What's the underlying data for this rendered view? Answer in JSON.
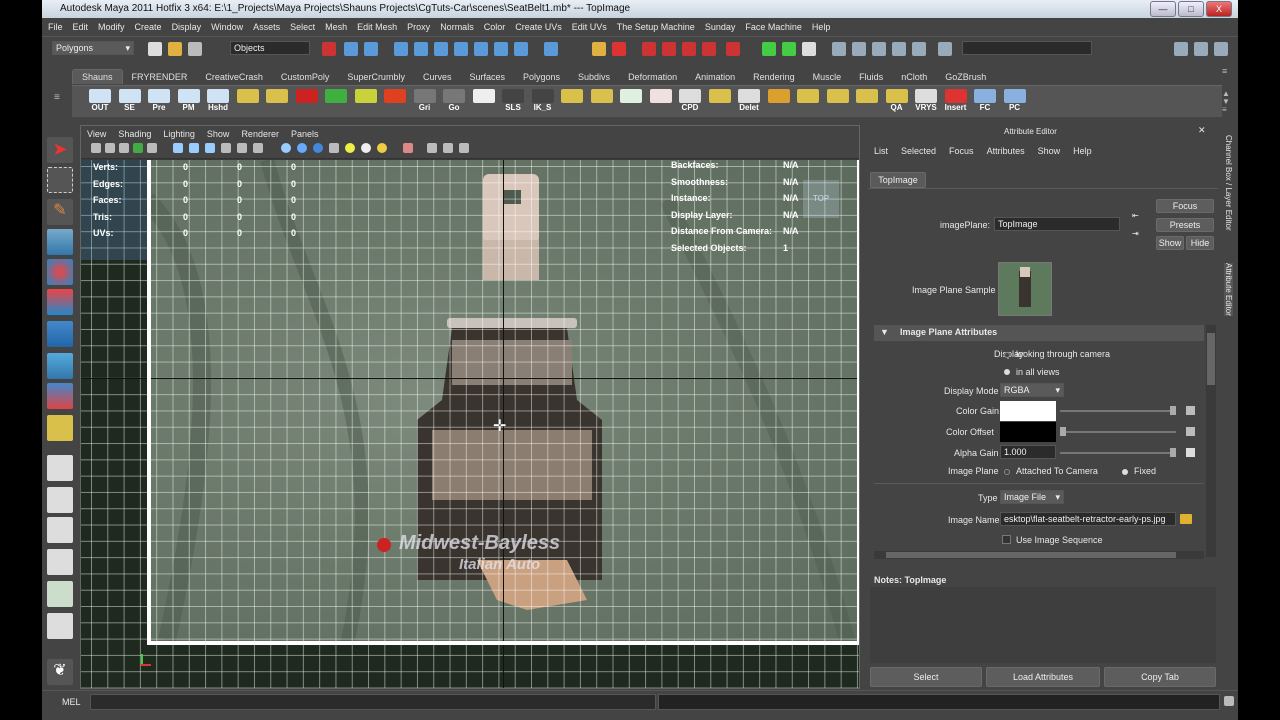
{
  "titlebar": {
    "title": "Autodesk Maya 2011 Hotfix 3 x64: E:\\1_Projects\\Maya Projects\\Shauns Projects\\CgTuts-Car\\scenes\\SeatBelt1.mb*   ---   TopImage",
    "min": "—",
    "max": "□",
    "close": "X"
  },
  "menubar": [
    "File",
    "Edit",
    "Modify",
    "Create",
    "Display",
    "Window",
    "Assets",
    "Select",
    "Mesh",
    "Edit Mesh",
    "Proxy",
    "Normals",
    "Color",
    "Create UVs",
    "Edit UVs",
    "The Setup Machine",
    "Sunday",
    "Face Machine",
    "Help"
  ],
  "statusline": {
    "mode": "Polygons",
    "selection_mode": "Objects"
  },
  "shelf_tabs": [
    "Shauns",
    "FRYRENDER",
    "CreativeCrash",
    "CustomPoly",
    "SuperCrumbly",
    "Curves",
    "Surfaces",
    "Polygons",
    "Subdivs",
    "Deformation",
    "Animation",
    "Rendering",
    "Muscle",
    "Fluids",
    "nCloth",
    "GoZBrush"
  ],
  "shelf_buttons": [
    {
      "label": "OUT",
      "color": "#cfe3f5"
    },
    {
      "label": "SE",
      "color": "#cfe3f5"
    },
    {
      "label": "Pre",
      "color": "#cfe3f5"
    },
    {
      "label": "PM",
      "color": "#cfe3f5"
    },
    {
      "label": "Hshd",
      "color": "#cfe3f5"
    },
    {
      "label": "",
      "color": "#d9c04a"
    },
    {
      "label": "",
      "color": "#d9c04a"
    },
    {
      "label": "",
      "color": "#cc2222"
    },
    {
      "label": "",
      "color": "#3fb03f"
    },
    {
      "label": "",
      "color": "#c8d23a"
    },
    {
      "label": "",
      "color": "#e04020"
    },
    {
      "label": "Gri",
      "color": "#777"
    },
    {
      "label": "Go",
      "color": "#777"
    },
    {
      "label": "",
      "color": "#eee"
    },
    {
      "label": "SLS",
      "color": "#444"
    },
    {
      "label": "IK_S",
      "color": "#444"
    },
    {
      "label": "",
      "color": "#d9c04a"
    },
    {
      "label": "",
      "color": "#d9c04a"
    },
    {
      "label": "",
      "color": "#e0f0e0"
    },
    {
      "label": "",
      "color": "#f0e0e0"
    },
    {
      "label": "CPD",
      "color": "#ddd"
    },
    {
      "label": "",
      "color": "#d9c04a"
    },
    {
      "label": "Delet",
      "color": "#ddd"
    },
    {
      "label": "",
      "color": "#d9a030"
    },
    {
      "label": "",
      "color": "#d9c04a"
    },
    {
      "label": "",
      "color": "#d9c04a"
    },
    {
      "label": "",
      "color": "#d9c04a"
    },
    {
      "label": "QA",
      "color": "#d9c04a"
    },
    {
      "label": "VRYS",
      "color": "#ddd"
    },
    {
      "label": "Insert",
      "color": "#d33"
    },
    {
      "label": "FC",
      "color": "#8ab0e0"
    },
    {
      "label": "PC",
      "color": "#8ab0e0"
    }
  ],
  "viewport": {
    "menu": [
      "View",
      "Shading",
      "Lighting",
      "Show",
      "Renderer",
      "Panels"
    ],
    "hud_left": [
      {
        "label": "Verts:",
        "v1": "0",
        "v2": "0",
        "v3": "0"
      },
      {
        "label": "Edges:",
        "v1": "0",
        "v2": "0",
        "v3": "0"
      },
      {
        "label": "Faces:",
        "v1": "0",
        "v2": "0",
        "v3": "0"
      },
      {
        "label": "Tris:",
        "v1": "0",
        "v2": "0",
        "v3": "0"
      },
      {
        "label": "UVs:",
        "v1": "0",
        "v2": "0",
        "v3": "0"
      }
    ],
    "hud_right": [
      {
        "label": "Backfaces:",
        "value": "N/A"
      },
      {
        "label": "Smoothness:",
        "value": "N/A"
      },
      {
        "label": "Instance:",
        "value": "N/A"
      },
      {
        "label": "Display Layer:",
        "value": "N/A"
      },
      {
        "label": "Distance From Camera:",
        "value": "N/A"
      },
      {
        "label": "Selected Objects:",
        "value": "1"
      }
    ],
    "view_cube": "TOP",
    "photo_text_1": "Midwest-Bayless",
    "photo_text_2": "Italian Auto"
  },
  "attr_editor": {
    "title": "Attribute Editor",
    "menu": [
      "List",
      "Selected",
      "Focus",
      "Attributes",
      "Show",
      "Help"
    ],
    "tab": "TopImage",
    "image_plane_label": "imagePlane:",
    "image_plane_value": "TopImage",
    "focus": "Focus",
    "presets": "Presets",
    "show": "Show",
    "hide": "Hide",
    "sample_label": "Image Plane Sample",
    "section": "Image Plane Attributes",
    "display_label": "Display",
    "display_opt1": "looking through camera",
    "display_opt2": "in all views",
    "display_mode_label": "Display Mode",
    "display_mode_value": "RGBA",
    "color_gain_label": "Color Gain",
    "color_offset_label": "Color Offset",
    "alpha_gain_label": "Alpha Gain",
    "alpha_gain_value": "1.000",
    "image_plane_opt_label": "Image Plane",
    "attached": "Attached To Camera",
    "fixed": "Fixed",
    "type_label": "Type",
    "type_value": "Image File",
    "image_name_label": "Image Name",
    "image_name_value": "esktop\\flat-seatbelt-retractor-early-ps.jpg",
    "use_sequence": "Use Image Sequence",
    "notes_label": "Notes:  TopImage",
    "btn_select": "Select",
    "btn_load": "Load Attributes",
    "btn_copy": "Copy Tab",
    "side_tab_1": "Channel Box / Layer Editor",
    "side_tab_2": "Attribute Editor"
  },
  "bottom": {
    "mel": "MEL"
  }
}
